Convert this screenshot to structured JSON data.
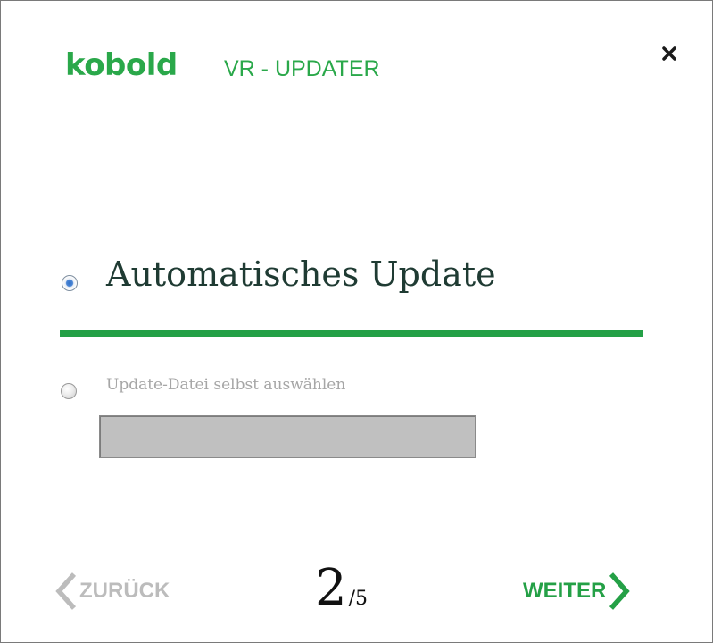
{
  "header": {
    "brand": "kobold",
    "app_title": "VR - UPDATER"
  },
  "options": {
    "automatic": {
      "label": "Automatisches Update",
      "selected": true
    },
    "manual_file": {
      "label": "Update-Datei selbst auswählen",
      "selected": false,
      "path_value": ""
    }
  },
  "footer": {
    "back_label": "ZURÜCK",
    "step_current": "2",
    "step_total": "/5",
    "next_label": "WEITER"
  },
  "colors": {
    "accent": "#24a046",
    "disabled": "#bcbcbc",
    "heading": "#1f3b33"
  },
  "icons": {
    "close": "close-icon",
    "back": "chevron-left-icon",
    "next": "chevron-right-icon"
  }
}
